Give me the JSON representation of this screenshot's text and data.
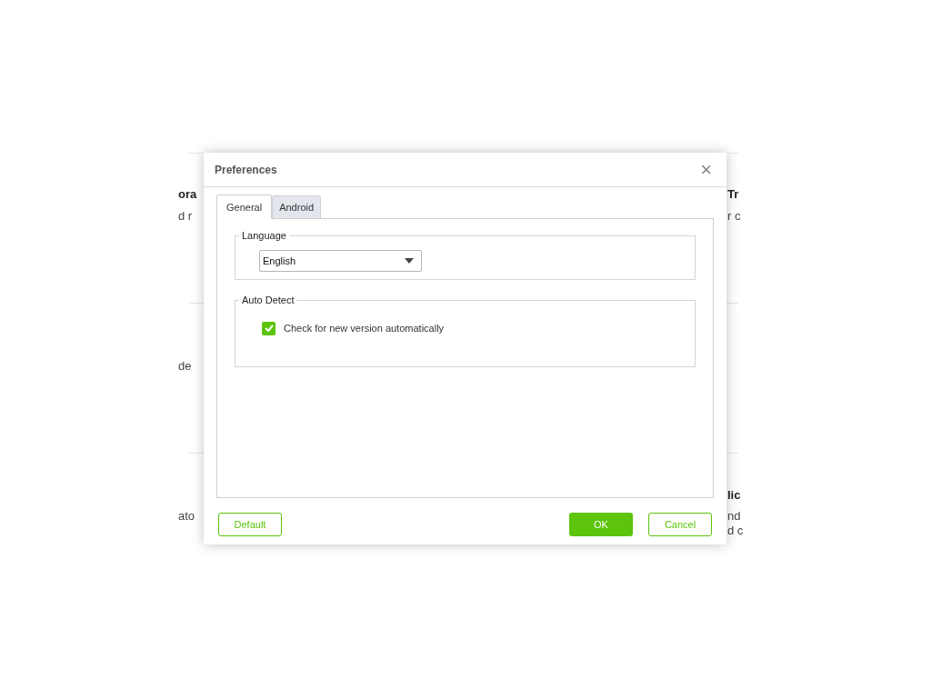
{
  "background": {
    "left_fragments": [
      {
        "text": "ora",
        "kind": "heading"
      },
      {
        "text": "d r",
        "kind": "text"
      },
      {
        "text": "de",
        "kind": "text"
      },
      {
        "text": "ato",
        "kind": "text"
      }
    ],
    "right_fragments": [
      {
        "text": "Tr",
        "kind": "heading"
      },
      {
        "text": "r c",
        "kind": "text"
      },
      {
        "text": "lic",
        "kind": "heading"
      },
      {
        "text": "nd",
        "kind": "text"
      },
      {
        "text": "d c",
        "kind": "text"
      }
    ]
  },
  "dialog": {
    "title": "Preferences",
    "close": "×",
    "tabs": [
      {
        "label": "General",
        "selected": true
      },
      {
        "label": "Android",
        "selected": false
      }
    ],
    "language": {
      "legend": "Language",
      "value": "English"
    },
    "auto_detect": {
      "legend": "Auto Detect",
      "option": {
        "label": "Check for new version automatically",
        "checked": true
      }
    },
    "buttons": [
      {
        "label": "Default",
        "kind": "outline"
      },
      {
        "label": "OK",
        "kind": "primary"
      },
      {
        "label": "Cancel",
        "kind": "outline"
      }
    ]
  }
}
